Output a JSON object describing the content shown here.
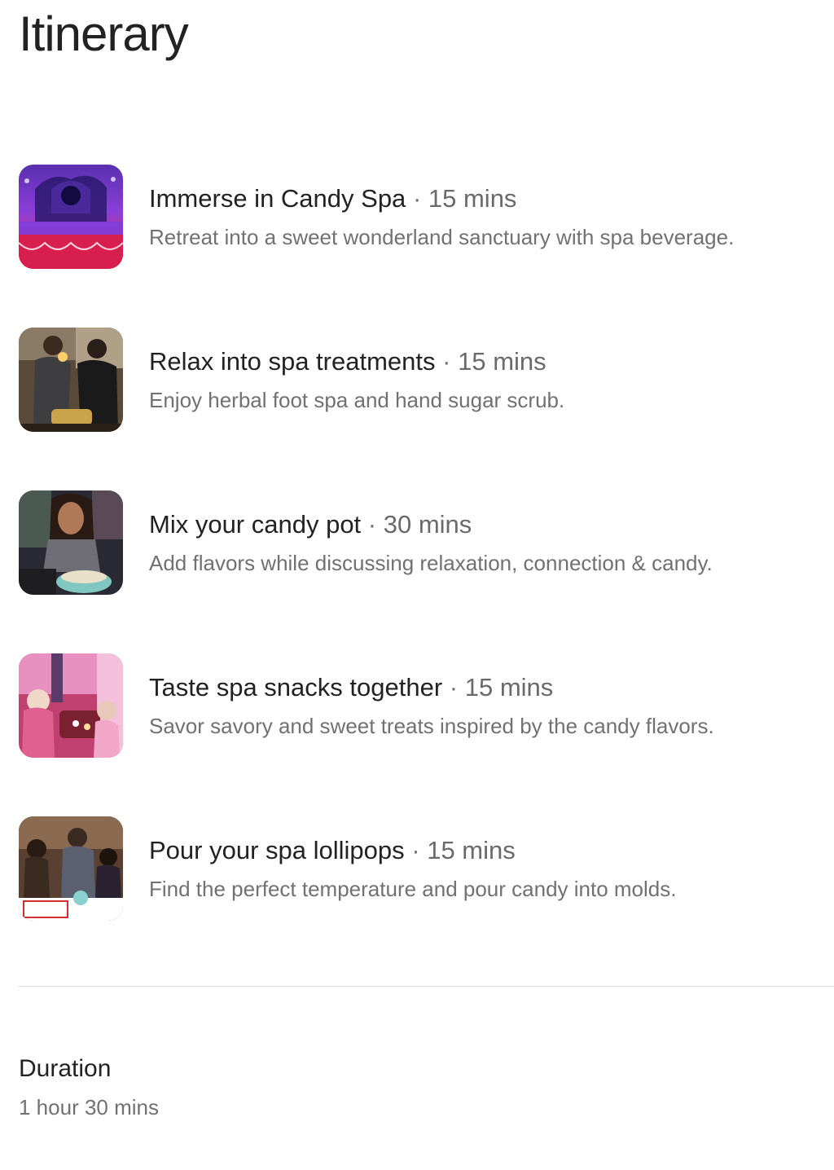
{
  "page": {
    "title": "Itinerary"
  },
  "itinerary": {
    "separator": "·",
    "items": [
      {
        "name": "Immerse in Candy Spa",
        "duration": "15 mins",
        "description": "Retreat into a sweet wonderland sanctuary with spa beverage."
      },
      {
        "name": "Relax into spa treatments",
        "duration": "15 mins",
        "description": "Enjoy herbal foot spa and hand sugar scrub."
      },
      {
        "name": "Mix your candy pot",
        "duration": "30 mins",
        "description": "Add flavors while discussing relaxation, connection & candy."
      },
      {
        "name": "Taste spa snacks together",
        "duration": "15 mins",
        "description": "Savor savory and sweet treats inspired by the candy flavors."
      },
      {
        "name": "Pour your spa lollipops",
        "duration": "15 mins",
        "description": "Find the perfect temperature and pour candy into molds."
      }
    ]
  },
  "summary": {
    "duration_label": "Duration",
    "duration_value": "1 hour 30 mins"
  },
  "colors": {
    "text_primary": "#222222",
    "text_secondary": "#717171",
    "divider": "#dddddd"
  }
}
